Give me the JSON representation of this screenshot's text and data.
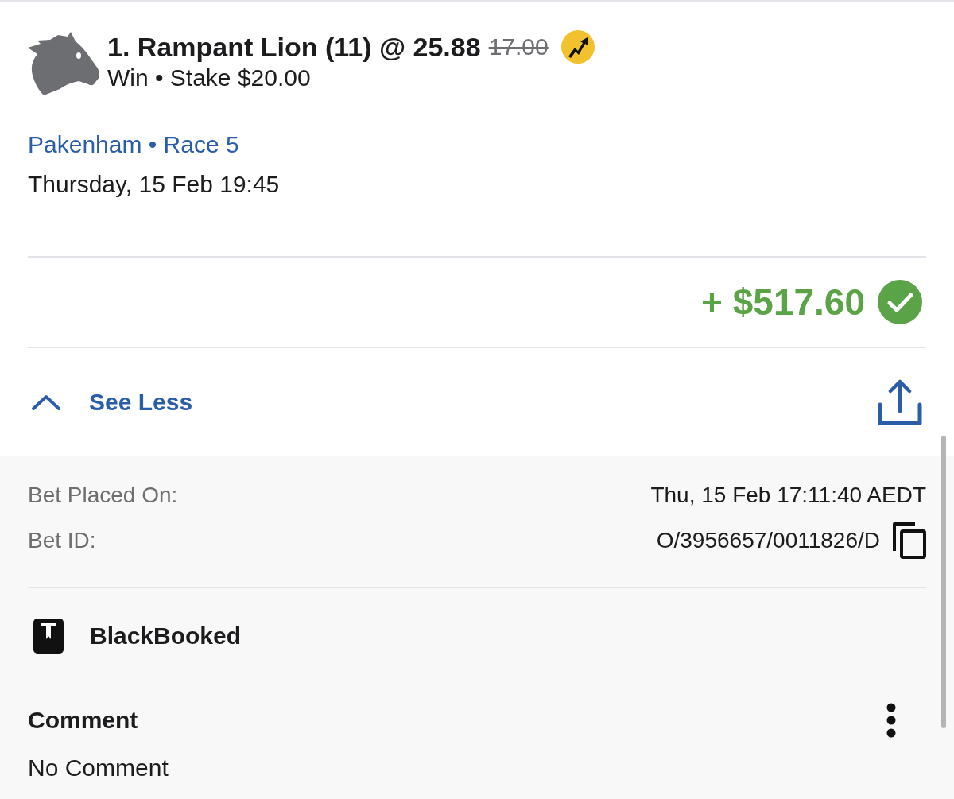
{
  "bet": {
    "selection": "1. Rampant Lion (11) @ 25.88",
    "previous_odds": "17.00",
    "boosted": true,
    "subtitle": "Win • Stake $20.00"
  },
  "event": {
    "venue_race": "Pakenham • Race 5",
    "start_time": "Thursday, 15 Feb 19:45"
  },
  "result": {
    "payout": "+ $517.60",
    "won": true
  },
  "toggle": {
    "label": "See Less",
    "expanded": true
  },
  "details": [
    {
      "label": "Bet Placed On:",
      "value": "Thu, 15 Feb 17:11:40 AEDT",
      "copyable": false
    },
    {
      "label": "Bet ID:",
      "value": "O/3956657/0011826/D",
      "copyable": true
    }
  ],
  "blackbook": {
    "label": "BlackBooked"
  },
  "comment": {
    "title": "Comment",
    "text": "No Comment"
  }
}
